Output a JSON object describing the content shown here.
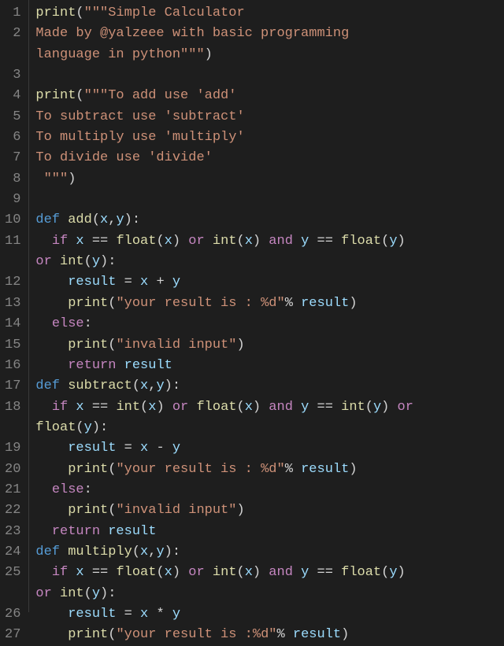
{
  "editor": {
    "language": "python",
    "tab_size": 2,
    "line_numbers": [
      "1",
      "2",
      "",
      "3",
      "4",
      "5",
      "6",
      "7",
      "8",
      "9",
      "10",
      "11",
      "",
      "12",
      "13",
      "14",
      "15",
      "16",
      "17",
      "18",
      "",
      "19",
      "20",
      "21",
      "22",
      "23",
      "24",
      "25",
      "",
      "26",
      "27"
    ],
    "lines": [
      {
        "n": 1,
        "segments": [
          {
            "t": "print",
            "c": "fn"
          },
          {
            "t": "(",
            "c": "op"
          },
          {
            "t": "\"\"\"Simple Calculator",
            "c": "str"
          }
        ]
      },
      {
        "n": 2,
        "segments": [
          {
            "t": "Made by @yalzeee with basic programming ",
            "c": "str"
          }
        ]
      },
      {
        "n": 2,
        "wrap": true,
        "segments": [
          {
            "t": "language in python\"\"\"",
            "c": "str"
          },
          {
            "t": ")",
            "c": "op"
          }
        ]
      },
      {
        "n": 3,
        "segments": []
      },
      {
        "n": 4,
        "segments": [
          {
            "t": "print",
            "c": "fn"
          },
          {
            "t": "(",
            "c": "op"
          },
          {
            "t": "\"\"\"To add use 'add'",
            "c": "str"
          }
        ]
      },
      {
        "n": 5,
        "segments": [
          {
            "t": "To subtract use 'subtract'",
            "c": "str"
          }
        ]
      },
      {
        "n": 6,
        "segments": [
          {
            "t": "To multiply use 'multiply'",
            "c": "str"
          }
        ]
      },
      {
        "n": 7,
        "segments": [
          {
            "t": "To divide use 'divide'",
            "c": "str"
          }
        ]
      },
      {
        "n": 8,
        "segments": [
          {
            "t": " \"\"\"",
            "c": "str"
          },
          {
            "t": ")",
            "c": "op"
          }
        ]
      },
      {
        "n": 9,
        "segments": []
      },
      {
        "n": 10,
        "segments": [
          {
            "t": "def",
            "c": "kw2"
          },
          {
            "t": " ",
            "c": "op"
          },
          {
            "t": "add",
            "c": "def"
          },
          {
            "t": "(",
            "c": "op"
          },
          {
            "t": "x",
            "c": "var"
          },
          {
            "t": ",",
            "c": "op"
          },
          {
            "t": "y",
            "c": "var"
          },
          {
            "t": "):",
            "c": "op"
          }
        ]
      },
      {
        "n": 11,
        "segments": [
          {
            "t": "  ",
            "c": "op"
          },
          {
            "t": "if",
            "c": "kw"
          },
          {
            "t": " ",
            "c": "op"
          },
          {
            "t": "x",
            "c": "var"
          },
          {
            "t": " == ",
            "c": "op"
          },
          {
            "t": "float",
            "c": "fn"
          },
          {
            "t": "(",
            "c": "op"
          },
          {
            "t": "x",
            "c": "var"
          },
          {
            "t": ") ",
            "c": "op"
          },
          {
            "t": "or",
            "c": "kw"
          },
          {
            "t": " ",
            "c": "op"
          },
          {
            "t": "int",
            "c": "fn"
          },
          {
            "t": "(",
            "c": "op"
          },
          {
            "t": "x",
            "c": "var"
          },
          {
            "t": ") ",
            "c": "op"
          },
          {
            "t": "and",
            "c": "kw"
          },
          {
            "t": " ",
            "c": "op"
          },
          {
            "t": "y",
            "c": "var"
          },
          {
            "t": " == ",
            "c": "op"
          },
          {
            "t": "float",
            "c": "fn"
          },
          {
            "t": "(",
            "c": "op"
          },
          {
            "t": "y",
            "c": "var"
          },
          {
            "t": ") ",
            "c": "op"
          }
        ]
      },
      {
        "n": 11,
        "wrap": true,
        "segments": [
          {
            "t": "or",
            "c": "kw"
          },
          {
            "t": " ",
            "c": "op"
          },
          {
            "t": "int",
            "c": "fn"
          },
          {
            "t": "(",
            "c": "op"
          },
          {
            "t": "y",
            "c": "var"
          },
          {
            "t": "):",
            "c": "op"
          }
        ]
      },
      {
        "n": 12,
        "segments": [
          {
            "t": "    ",
            "c": "op"
          },
          {
            "t": "result",
            "c": "var"
          },
          {
            "t": " = ",
            "c": "op"
          },
          {
            "t": "x",
            "c": "var"
          },
          {
            "t": " + ",
            "c": "op"
          },
          {
            "t": "y",
            "c": "var"
          }
        ]
      },
      {
        "n": 13,
        "segments": [
          {
            "t": "    ",
            "c": "op"
          },
          {
            "t": "print",
            "c": "fn"
          },
          {
            "t": "(",
            "c": "op"
          },
          {
            "t": "\"your result is : %d\"",
            "c": "str"
          },
          {
            "t": "% ",
            "c": "op"
          },
          {
            "t": "result",
            "c": "var"
          },
          {
            "t": ")",
            "c": "op"
          }
        ]
      },
      {
        "n": 14,
        "segments": [
          {
            "t": "  ",
            "c": "op"
          },
          {
            "t": "else",
            "c": "kw"
          },
          {
            "t": ":",
            "c": "op"
          }
        ]
      },
      {
        "n": 15,
        "segments": [
          {
            "t": "    ",
            "c": "op"
          },
          {
            "t": "print",
            "c": "fn"
          },
          {
            "t": "(",
            "c": "op"
          },
          {
            "t": "\"invalid input\"",
            "c": "str"
          },
          {
            "t": ")",
            "c": "op"
          }
        ]
      },
      {
        "n": 16,
        "segments": [
          {
            "t": "    ",
            "c": "op"
          },
          {
            "t": "return",
            "c": "kw"
          },
          {
            "t": " ",
            "c": "op"
          },
          {
            "t": "result",
            "c": "var"
          }
        ]
      },
      {
        "n": 17,
        "segments": [
          {
            "t": "def",
            "c": "kw2"
          },
          {
            "t": " ",
            "c": "op"
          },
          {
            "t": "subtract",
            "c": "def"
          },
          {
            "t": "(",
            "c": "op"
          },
          {
            "t": "x",
            "c": "var"
          },
          {
            "t": ",",
            "c": "op"
          },
          {
            "t": "y",
            "c": "var"
          },
          {
            "t": "):",
            "c": "op"
          }
        ]
      },
      {
        "n": 18,
        "segments": [
          {
            "t": "  ",
            "c": "op"
          },
          {
            "t": "if",
            "c": "kw"
          },
          {
            "t": " ",
            "c": "op"
          },
          {
            "t": "x",
            "c": "var"
          },
          {
            "t": " == ",
            "c": "op"
          },
          {
            "t": "int",
            "c": "fn"
          },
          {
            "t": "(",
            "c": "op"
          },
          {
            "t": "x",
            "c": "var"
          },
          {
            "t": ") ",
            "c": "op"
          },
          {
            "t": "or",
            "c": "kw"
          },
          {
            "t": " ",
            "c": "op"
          },
          {
            "t": "float",
            "c": "fn"
          },
          {
            "t": "(",
            "c": "op"
          },
          {
            "t": "x",
            "c": "var"
          },
          {
            "t": ") ",
            "c": "op"
          },
          {
            "t": "and",
            "c": "kw"
          },
          {
            "t": " ",
            "c": "op"
          },
          {
            "t": "y",
            "c": "var"
          },
          {
            "t": " == ",
            "c": "op"
          },
          {
            "t": "int",
            "c": "fn"
          },
          {
            "t": "(",
            "c": "op"
          },
          {
            "t": "y",
            "c": "var"
          },
          {
            "t": ") ",
            "c": "op"
          },
          {
            "t": "or",
            "c": "kw"
          },
          {
            "t": " ",
            "c": "op"
          }
        ]
      },
      {
        "n": 18,
        "wrap": true,
        "segments": [
          {
            "t": "float",
            "c": "fn"
          },
          {
            "t": "(",
            "c": "op"
          },
          {
            "t": "y",
            "c": "var"
          },
          {
            "t": "):",
            "c": "op"
          }
        ]
      },
      {
        "n": 19,
        "segments": [
          {
            "t": "    ",
            "c": "op"
          },
          {
            "t": "result",
            "c": "var"
          },
          {
            "t": " = ",
            "c": "op"
          },
          {
            "t": "x",
            "c": "var"
          },
          {
            "t": " - ",
            "c": "op"
          },
          {
            "t": "y",
            "c": "var"
          }
        ]
      },
      {
        "n": 20,
        "segments": [
          {
            "t": "    ",
            "c": "op"
          },
          {
            "t": "print",
            "c": "fn"
          },
          {
            "t": "(",
            "c": "op"
          },
          {
            "t": "\"your result is : %d\"",
            "c": "str"
          },
          {
            "t": "% ",
            "c": "op"
          },
          {
            "t": "result",
            "c": "var"
          },
          {
            "t": ")",
            "c": "op"
          }
        ]
      },
      {
        "n": 21,
        "segments": [
          {
            "t": "  ",
            "c": "op"
          },
          {
            "t": "else",
            "c": "kw"
          },
          {
            "t": ":",
            "c": "op"
          }
        ]
      },
      {
        "n": 22,
        "segments": [
          {
            "t": "    ",
            "c": "op"
          },
          {
            "t": "print",
            "c": "fn"
          },
          {
            "t": "(",
            "c": "op"
          },
          {
            "t": "\"invalid input\"",
            "c": "str"
          },
          {
            "t": ")",
            "c": "op"
          }
        ]
      },
      {
        "n": 23,
        "segments": [
          {
            "t": "  ",
            "c": "op"
          },
          {
            "t": "return",
            "c": "kw"
          },
          {
            "t": " ",
            "c": "op"
          },
          {
            "t": "result",
            "c": "var"
          }
        ]
      },
      {
        "n": 24,
        "segments": [
          {
            "t": "def",
            "c": "kw2"
          },
          {
            "t": " ",
            "c": "op"
          },
          {
            "t": "multiply",
            "c": "def"
          },
          {
            "t": "(",
            "c": "op"
          },
          {
            "t": "x",
            "c": "var"
          },
          {
            "t": ",",
            "c": "op"
          },
          {
            "t": "y",
            "c": "var"
          },
          {
            "t": "):",
            "c": "op"
          }
        ]
      },
      {
        "n": 25,
        "segments": [
          {
            "t": "  ",
            "c": "op"
          },
          {
            "t": "if",
            "c": "kw"
          },
          {
            "t": " ",
            "c": "op"
          },
          {
            "t": "x",
            "c": "var"
          },
          {
            "t": " == ",
            "c": "op"
          },
          {
            "t": "float",
            "c": "fn"
          },
          {
            "t": "(",
            "c": "op"
          },
          {
            "t": "x",
            "c": "var"
          },
          {
            "t": ") ",
            "c": "op"
          },
          {
            "t": "or",
            "c": "kw"
          },
          {
            "t": " ",
            "c": "op"
          },
          {
            "t": "int",
            "c": "fn"
          },
          {
            "t": "(",
            "c": "op"
          },
          {
            "t": "x",
            "c": "var"
          },
          {
            "t": ") ",
            "c": "op"
          },
          {
            "t": "and",
            "c": "kw"
          },
          {
            "t": " ",
            "c": "op"
          },
          {
            "t": "y",
            "c": "var"
          },
          {
            "t": " == ",
            "c": "op"
          },
          {
            "t": "float",
            "c": "fn"
          },
          {
            "t": "(",
            "c": "op"
          },
          {
            "t": "y",
            "c": "var"
          },
          {
            "t": ") ",
            "c": "op"
          }
        ]
      },
      {
        "n": 25,
        "wrap": true,
        "segments": [
          {
            "t": "or",
            "c": "kw"
          },
          {
            "t": " ",
            "c": "op"
          },
          {
            "t": "int",
            "c": "fn"
          },
          {
            "t": "(",
            "c": "op"
          },
          {
            "t": "y",
            "c": "var"
          },
          {
            "t": "):",
            "c": "op"
          }
        ]
      },
      {
        "n": 26,
        "segments": [
          {
            "t": "    ",
            "c": "op"
          },
          {
            "t": "result",
            "c": "var"
          },
          {
            "t": " = ",
            "c": "op"
          },
          {
            "t": "x",
            "c": "var"
          },
          {
            "t": " * ",
            "c": "op"
          },
          {
            "t": "y",
            "c": "var"
          }
        ]
      },
      {
        "n": 27,
        "segments": [
          {
            "t": "    ",
            "c": "op"
          },
          {
            "t": "print",
            "c": "fn"
          },
          {
            "t": "(",
            "c": "op"
          },
          {
            "t": "\"your result is :%d\"",
            "c": "str"
          },
          {
            "t": "% ",
            "c": "op"
          },
          {
            "t": "result",
            "c": "var"
          },
          {
            "t": ")",
            "c": "op"
          }
        ]
      }
    ]
  }
}
